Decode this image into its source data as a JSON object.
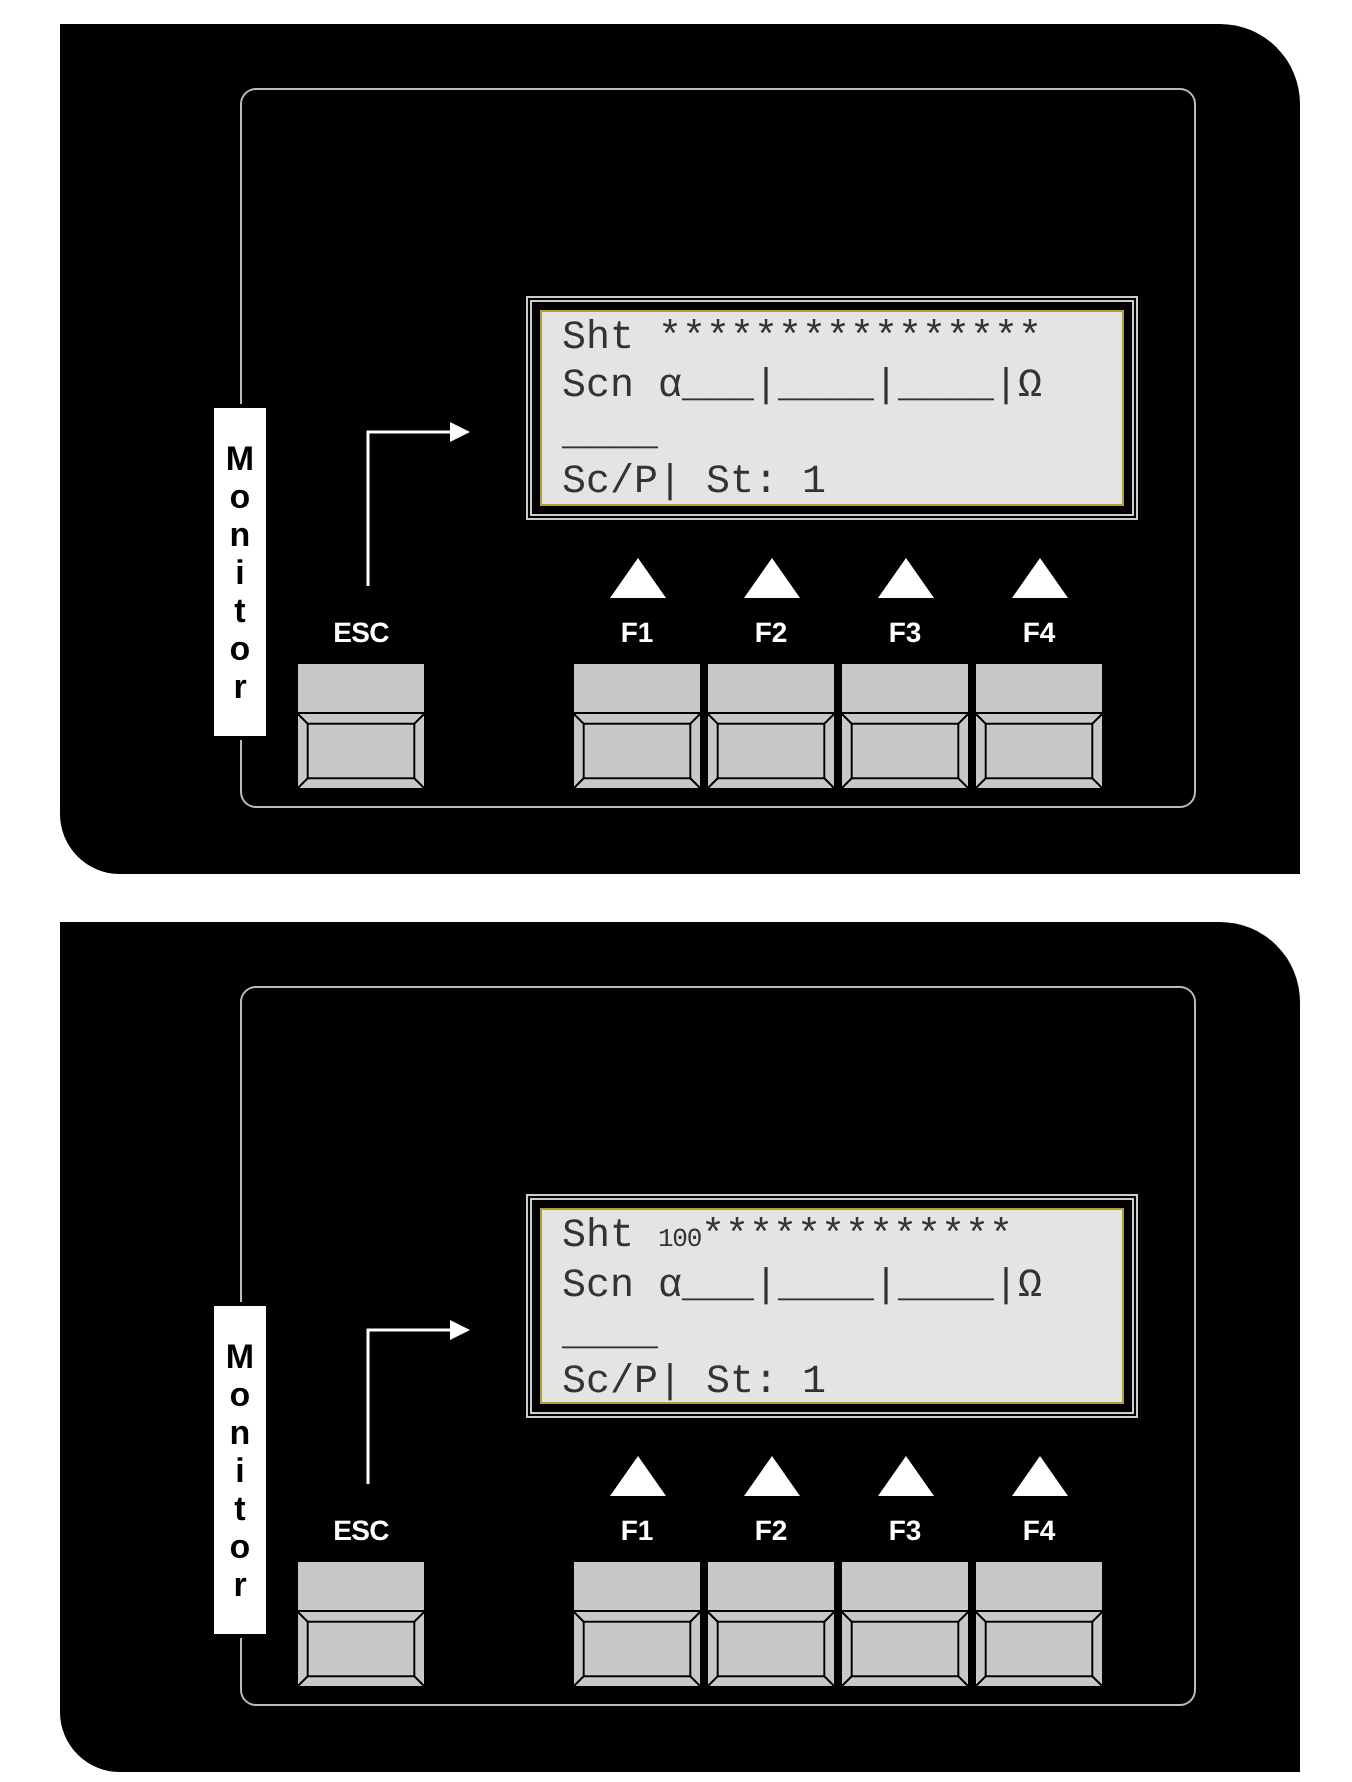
{
  "panels": [
    {
      "side_label": "Monitor",
      "lcd_lines": [
        {
          "kind": "gauge",
          "label": "Sht",
          "stars": "****************"
        },
        {
          "kind": "text",
          "text": "Scn α___|____|____|Ω"
        },
        {
          "kind": "text",
          "text": "____"
        },
        {
          "kind": "text",
          "text": "Sc/P| St: 1"
        }
      ],
      "escape_key": {
        "label": "ESC"
      },
      "function_keys": [
        {
          "label": "F1"
        },
        {
          "label": "F2"
        },
        {
          "label": "F3"
        },
        {
          "label": "F4"
        }
      ]
    },
    {
      "side_label": "Monitor",
      "lcd_lines": [
        {
          "kind": "gauge",
          "label": "Sht",
          "value": "100",
          "stars": "*************"
        },
        {
          "kind": "text",
          "text": "Scn α___|____|____|Ω"
        },
        {
          "kind": "text",
          "text": "____"
        },
        {
          "kind": "text",
          "text": "Sc/P| St: 1"
        }
      ],
      "escape_key": {
        "label": "ESC"
      },
      "function_keys": [
        {
          "label": "F1"
        },
        {
          "label": "F2"
        },
        {
          "label": "F3"
        },
        {
          "label": "F4"
        }
      ]
    }
  ]
}
